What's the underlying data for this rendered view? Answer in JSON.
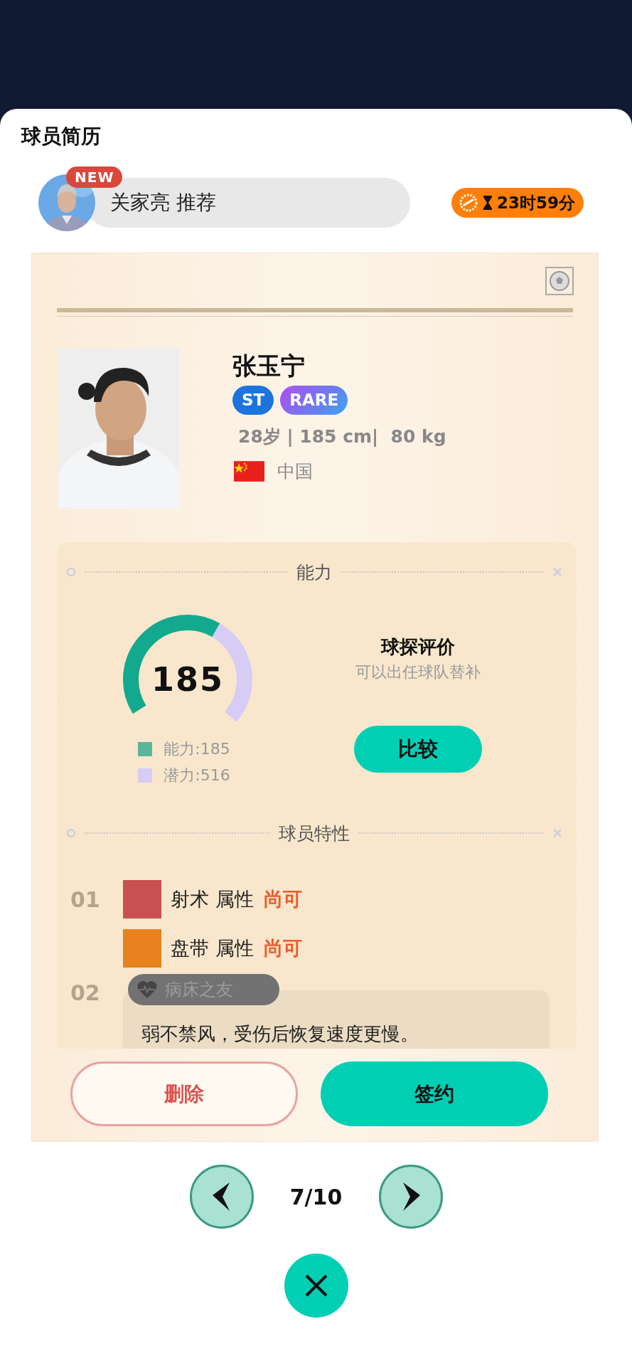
{
  "sheet": {
    "title": "球员简历"
  },
  "recommendation": {
    "badge": "NEW",
    "text": "关家亮 推荐",
    "timer": "23时59分"
  },
  "player": {
    "name": "张玉宁",
    "tags": [
      {
        "label": "ST",
        "kind": "position"
      },
      {
        "label": "RARE",
        "kind": "rarity"
      }
    ],
    "stats": "28岁 | 185 cm|  80 kg",
    "nationality": "中国"
  },
  "ability": {
    "title": "能力",
    "score": "185",
    "legend": [
      {
        "label": "能力:185",
        "color": "#5bb59a"
      },
      {
        "label": "潜力:516",
        "color": "#d6ccf5"
      }
    ],
    "scout_title": "球探评价",
    "scout_text": "可以出任球队替补",
    "compare_button": "比较"
  },
  "traits": {
    "title": "球员特性",
    "groups": [
      {
        "kind": "attributes",
        "number": "01",
        "items": [
          {
            "label": "射术 属性",
            "rating": "尚可",
            "color": "#c95050"
          },
          {
            "label": "盘带 属性",
            "rating": "尚可",
            "color": "#e8821f"
          }
        ]
      },
      {
        "kind": "special",
        "number": "02",
        "tag": "病床之友",
        "description": "弱不禁风，受伤后恢复速度更慢。"
      }
    ]
  },
  "actions": [
    {
      "label": "删除",
      "kind": "secondary"
    },
    {
      "label": "签约",
      "kind": "primary"
    }
  ],
  "pager": {
    "text": "7/10"
  }
}
